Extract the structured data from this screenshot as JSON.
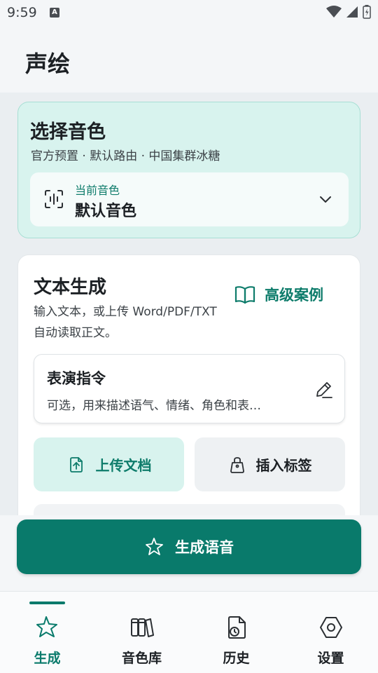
{
  "status_bar": {
    "time": "9:59",
    "notification_icon": "A"
  },
  "header": {
    "title": "声绘"
  },
  "voice_card": {
    "title": "选择音色",
    "subtitle": "官方预置 · 默认路由 · 中国集群冰糖",
    "current_label": "当前音色",
    "current_value": "默认音色",
    "icons": [
      "voice-wave-icon",
      "chevron-down-icon"
    ]
  },
  "text_card": {
    "title": "文本生成",
    "description": "输入文本，或上传 Word/PDF/TXT 自动读取正文。",
    "advanced_link": "高级案例",
    "performance": {
      "title": "表演指令",
      "hint": "可选，用来描述语气、情绪、角色和表…"
    },
    "upload_button": "上传文档",
    "insert_tag_button": "插入标签"
  },
  "generate_button": {
    "label": "生成语音"
  },
  "bottom_nav": {
    "items": [
      {
        "label": "生成",
        "icon": "sparkle-icon",
        "active": true
      },
      {
        "label": "音色库",
        "icon": "library-icon",
        "active": false
      },
      {
        "label": "历史",
        "icon": "history-icon",
        "active": false
      },
      {
        "label": "设置",
        "icon": "settings-icon",
        "active": false
      }
    ]
  },
  "colors": {
    "accent": "#097a6b",
    "accent_text": "#0e7c6b",
    "accent_soft": "#d8f3ee"
  }
}
